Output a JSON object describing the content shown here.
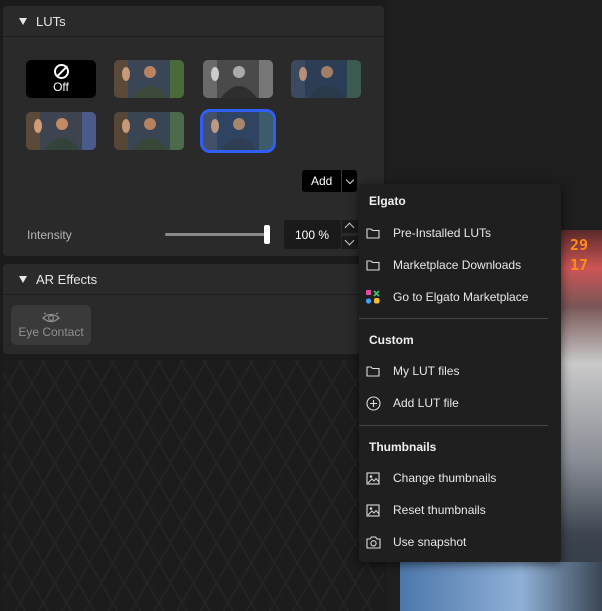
{
  "luts_panel": {
    "title": "LUTs",
    "thumbnails": [
      {
        "label": "Off"
      },
      {
        "label": ""
      },
      {
        "label": ""
      },
      {
        "label": ""
      },
      {
        "label": ""
      },
      {
        "label": ""
      },
      {
        "label": ""
      }
    ],
    "selected_index": 6,
    "add_button": "Add",
    "intensity_label": "Intensity",
    "intensity_value": "100 %",
    "intensity_level": 1.0
  },
  "ar_panel": {
    "title": "AR Effects",
    "eye_contact_label": "Eye Contact"
  },
  "preview": {
    "score_top": "29",
    "score_bottom": "17"
  },
  "menu": {
    "sections": [
      {
        "header": "Elgato",
        "items": [
          {
            "label": "Pre-Installed LUTs",
            "icon": "folder-icon"
          },
          {
            "label": "Marketplace Downloads",
            "icon": "folder-icon"
          },
          {
            "label": "Go to Elgato Marketplace",
            "icon": "marketplace-icon"
          }
        ]
      },
      {
        "header": "Custom",
        "items": [
          {
            "label": "My LUT files",
            "icon": "folder-icon"
          },
          {
            "label": "Add LUT file",
            "icon": "plus-circle-icon"
          }
        ]
      },
      {
        "header": "Thumbnails",
        "items": [
          {
            "label": "Change thumbnails",
            "icon": "image-icon"
          },
          {
            "label": "Reset thumbnails",
            "icon": "image-icon"
          },
          {
            "label": "Use snapshot",
            "icon": "camera-icon"
          }
        ]
      }
    ]
  },
  "colors": {
    "accent_selected": "#2f5ff5",
    "score": "#ff8a1a"
  }
}
